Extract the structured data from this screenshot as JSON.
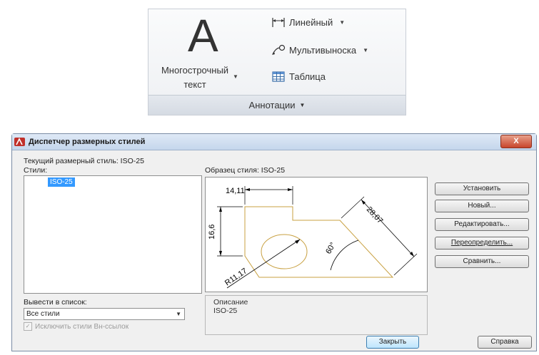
{
  "ribbon": {
    "multiline_text_icon": "A",
    "multiline_text_label": "Многострочный\nтекст",
    "linear_label": "Линейный",
    "multileader_label": "Мультивыноска",
    "table_label": "Таблица",
    "panel_title": "Аннотации",
    "dropdown_arrow": "▼"
  },
  "dialog": {
    "title": "Диспетчер размерных стилей",
    "close_glyph": "X",
    "current_style_label": "Текущий размерный стиль: ISO-25",
    "styles_label": "Стили:",
    "styles_list": [
      "ISO-25"
    ],
    "preview_label": "Образец стиля: ISO-25",
    "preview_dims": {
      "top": "14,11",
      "left": "16,6",
      "diagonal": "28,07",
      "angle": "60°",
      "radius": "R11,17"
    },
    "list_filter_label": "Вывести в список:",
    "list_filter_value": "Все стили",
    "exclude_xrefs_label": "Исключить стили Вн-ссылок",
    "description_label": "Описание",
    "description_value": "ISO-25",
    "buttons": {
      "set_current": "Установить",
      "new": "Новый...",
      "modify": "Редактировать...",
      "override": "Переопределить...",
      "compare": "Сравнить...",
      "close": "Закрыть",
      "help": "Справка"
    },
    "colors": {
      "selection": "#3399ff",
      "preview_outline": "#c8a040",
      "close_button": "#c7452c"
    }
  }
}
